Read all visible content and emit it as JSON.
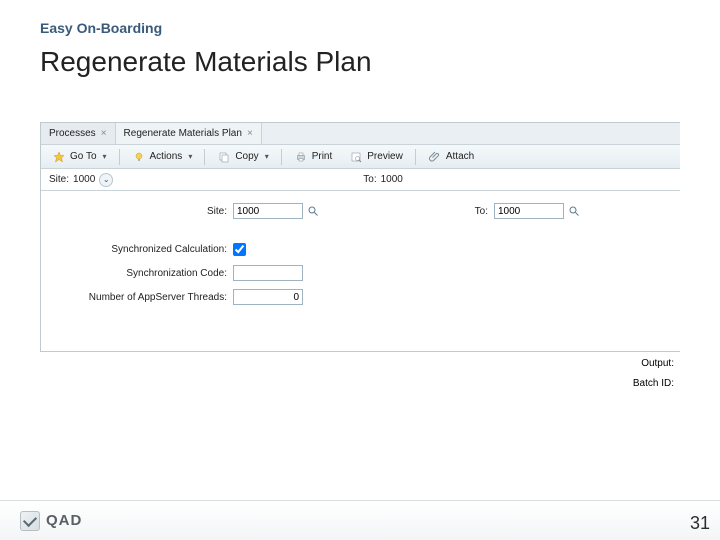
{
  "slide": {
    "subtitle": "Easy On-Boarding",
    "title": "Regenerate Materials Plan",
    "page": "31"
  },
  "logo": {
    "text": "QAD"
  },
  "tabs": [
    {
      "label": "Processes"
    },
    {
      "label": "Regenerate Materials Plan"
    }
  ],
  "toolbar": {
    "goto": "Go To",
    "actions": "Actions",
    "copy": "Copy",
    "print": "Print",
    "preview": "Preview",
    "attach": "Attach"
  },
  "filters": {
    "site_label": "Site:",
    "site_value": "1000",
    "to_label": "To:",
    "to_value": "1000"
  },
  "form": {
    "site_label": "Site:",
    "site_value": "1000",
    "to_label": "To:",
    "to_value": "1000",
    "sync_calc_label": "Synchronized Calculation:",
    "sync_code_label": "Synchronization Code:",
    "sync_code_value": "",
    "threads_label": "Number of AppServer Threads:",
    "threads_value": "0",
    "output_label": "Output:",
    "batch_label": "Batch ID:"
  }
}
